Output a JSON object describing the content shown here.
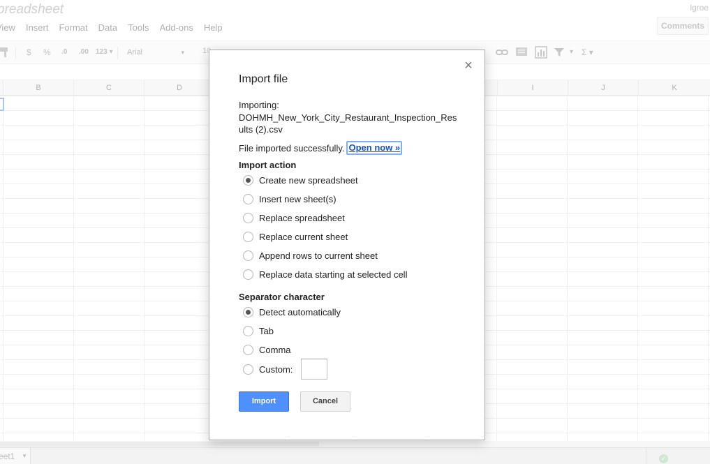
{
  "app": {
    "doc_title": "preadsheet",
    "user_name": "lgroe",
    "comments_label": "Comments",
    "menu": [
      "View",
      "Insert",
      "Format",
      "Data",
      "Tools",
      "Add-ons",
      "Help"
    ]
  },
  "toolbar": {
    "currency": "$",
    "percent": "%",
    "decrease_decimals": ".0",
    "increase_decimals": ".00",
    "more_formats": "123 ▾",
    "font": "Arial",
    "font_size": "10",
    "function_symbol": "Σ ▾"
  },
  "grid": {
    "columns": [
      "B",
      "C",
      "D",
      "I",
      "J",
      "K"
    ]
  },
  "sheet_tab": {
    "label": "eet1"
  },
  "dialog": {
    "title": "Import file",
    "importing_label": "Importing:",
    "filename": "DOHMH_New_York_City_Restaurant_Inspection_Results (2).csv",
    "success_text": "File imported successfully.",
    "open_now_label": "Open now »",
    "import_action_title": "Import action",
    "import_actions": [
      {
        "label": "Create new spreadsheet",
        "checked": true
      },
      {
        "label": "Insert new sheet(s)",
        "checked": false
      },
      {
        "label": "Replace spreadsheet",
        "checked": false
      },
      {
        "label": "Replace current sheet",
        "checked": false
      },
      {
        "label": "Append rows to current sheet",
        "checked": false
      },
      {
        "label": "Replace data starting at selected cell",
        "checked": false
      }
    ],
    "separator_title": "Separator character",
    "separators": [
      {
        "label": "Detect automatically",
        "checked": true
      },
      {
        "label": "Tab",
        "checked": false
      },
      {
        "label": "Comma",
        "checked": false
      },
      {
        "label": "Custom:",
        "checked": false
      }
    ],
    "custom_value": "",
    "import_button": "Import",
    "cancel_button": "Cancel",
    "close_symbol": "×"
  }
}
